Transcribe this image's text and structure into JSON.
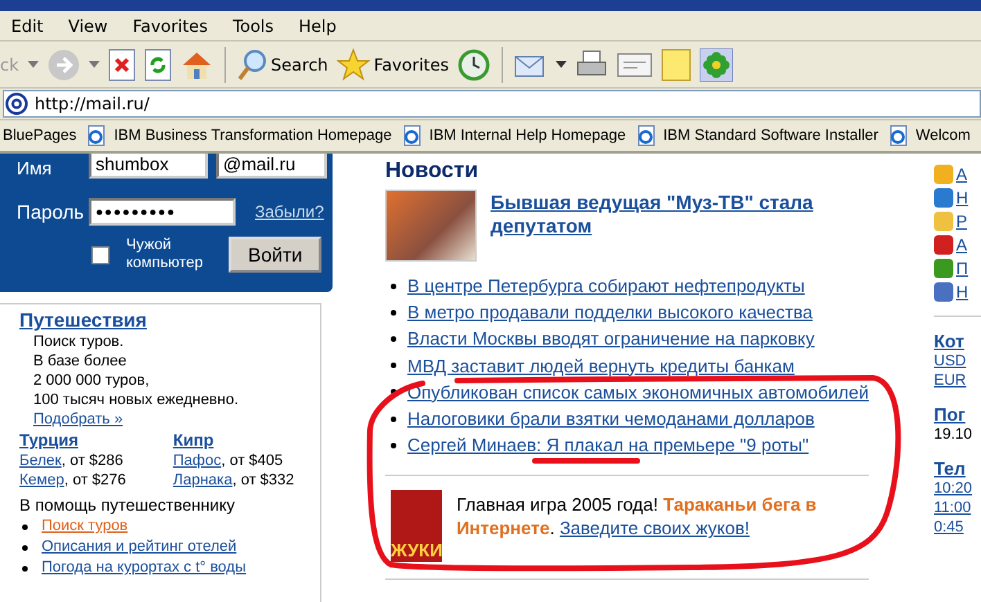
{
  "menu": [
    "Edit",
    "View",
    "Favorites",
    "Tools",
    "Help"
  ],
  "toolbar": {
    "back": {
      "label": "ck",
      "disabled": true
    },
    "forward": {
      "disabled": true
    },
    "search_label": "Search",
    "favorites_label": "Favorites"
  },
  "address": {
    "value": "http://mail.ru/"
  },
  "links": [
    "BluePages",
    "IBM Business Transformation Homepage",
    "IBM Internal Help Homepage",
    "IBM Standard Software Installer",
    "Welcom"
  ],
  "login": {
    "name_label": "Имя",
    "name_value": "shumbox",
    "domain": "@mail.ru",
    "password_label": "Пароль",
    "password_value": "●●●●●●●●●",
    "forgot": "Забыли?",
    "foreign_computer": {
      "label": "Чужой компьютер",
      "checked": false
    },
    "submit": "Войти"
  },
  "travel": {
    "title": "Путешествия",
    "intro_lines": [
      "Поиск туров.",
      "В базе более",
      "2 000 000 туров,",
      "100 тысяч новых ежедневно."
    ],
    "more": "Подобрать »",
    "countries": [
      {
        "name": "Турция",
        "offers": [
          {
            "city": "Белек",
            "price": ", от $286"
          },
          {
            "city": "Кемер",
            "price": ", от $276"
          }
        ]
      },
      {
        "name": "Кипр",
        "offers": [
          {
            "city": "Пафос",
            "price": ", от $405"
          },
          {
            "city": "Ларнака",
            "price": ", от $332"
          }
        ]
      }
    ],
    "helper_title": "В помощь путешественнику",
    "helper_links": [
      {
        "label": "Поиск туров",
        "visited": true
      },
      {
        "label": "Описания и рейтинг отелей",
        "visited": false
      },
      {
        "label": "Погода на курортах с t° воды",
        "visited": false
      }
    ]
  },
  "news": {
    "title": "Новости",
    "headline": "Бывшая ведущая \"Муз-ТВ\" стала депутатом",
    "items": [
      "В центре Петербурга собирают нефтепродукты",
      "В метро продавали подделки высокого качества",
      "Власти Москвы вводят ограничение на парковку",
      "МВД заставит людей вернуть кредиты банкам",
      "Опубликован список самых экономичных автомобилей",
      "Налоговики брали взятки чемоданами долларов",
      "Сергей Минаев: Я плакал на премьере \"9 роты\""
    ]
  },
  "promo": {
    "logo": "ЖУКИ",
    "lead": "Главная игра 2005 года!",
    "highlight": "Тараканьи бега в Интернете",
    "tail": ".",
    "link": "Заведите своих жуков!"
  },
  "side": {
    "services": [
      {
        "label": "А",
        "color": "#f0b020"
      },
      {
        "label": "Н",
        "color": "#2a7ad0"
      },
      {
        "label": "Р",
        "color": "#f0c040"
      },
      {
        "label": "А",
        "color": "#d02020"
      },
      {
        "label": "П",
        "color": "#3a9a20"
      },
      {
        "label": "Н",
        "color": "#4a70c0"
      }
    ],
    "rates": {
      "title": "Кот",
      "lines": [
        "USD",
        "EUR"
      ]
    },
    "weather": {
      "title": "Пог",
      "line": "19.10"
    },
    "tv": {
      "title": "Тел",
      "lines": [
        "10:20",
        "11:00",
        "0:45"
      ]
    }
  }
}
